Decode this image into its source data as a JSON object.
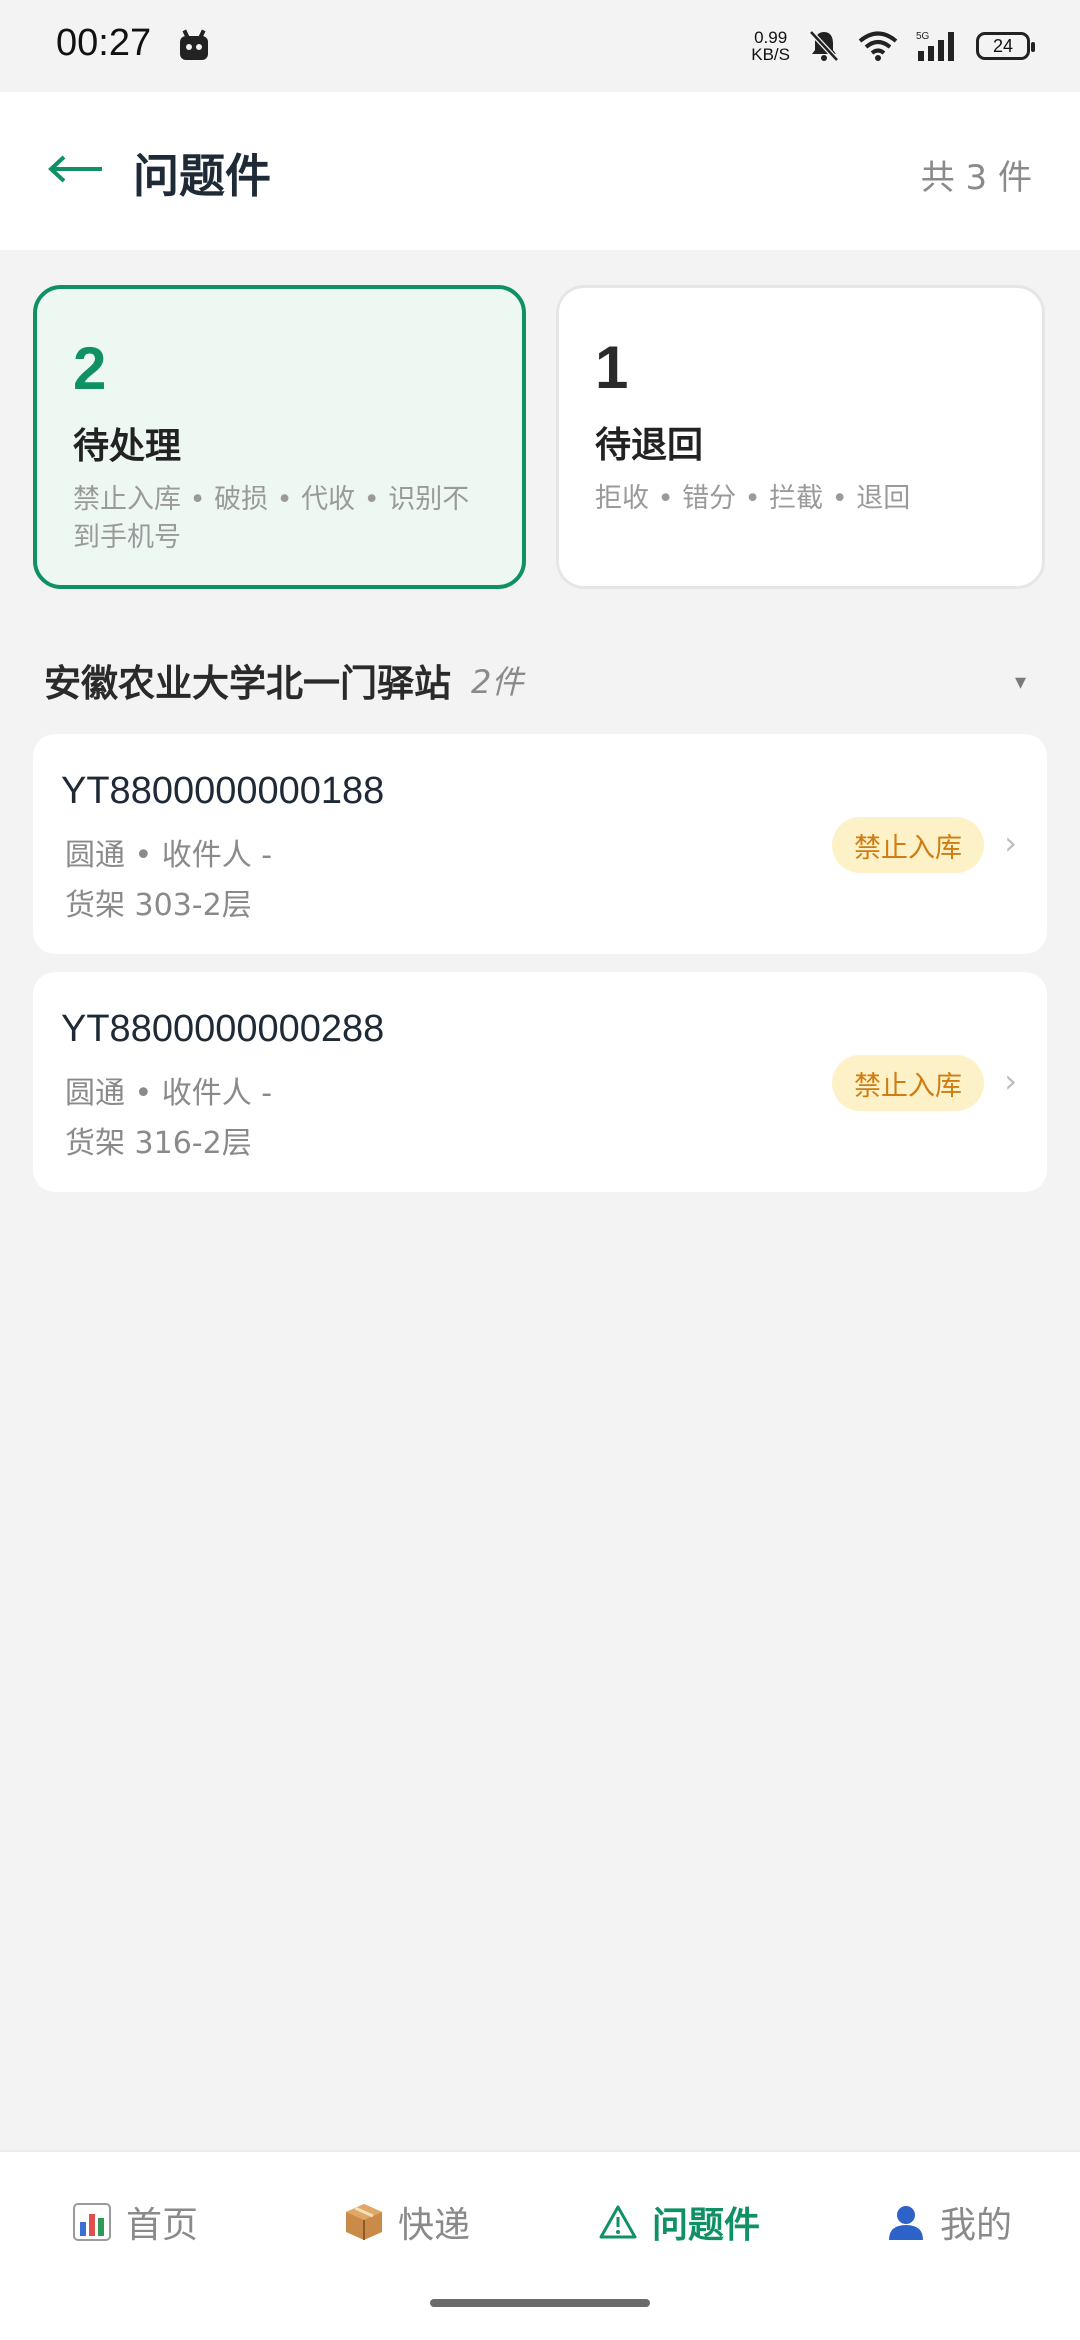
{
  "status_bar": {
    "time": "00:27",
    "net_speed_top": "0.99",
    "net_speed_bottom": "KB/S",
    "battery": "24",
    "icons": [
      "android-icon",
      "mute-bell-icon",
      "wifi-icon",
      "5g-signal-icon",
      "battery-icon"
    ]
  },
  "header": {
    "title": "问题件",
    "total": "共 3 件",
    "back_icon": "arrow-left-icon"
  },
  "summary": {
    "pending": {
      "count": "2",
      "label": "待处理",
      "desc": "禁止入库 • 破损 • 代收 • 识别不到手机号"
    },
    "return": {
      "count": "1",
      "label": "待退回",
      "desc": "拒收 • 错分 • 拦截 • 退回"
    }
  },
  "station": {
    "name": "安徽农业大学北一门驿站",
    "count": "2件",
    "dropdown_icon": "▾"
  },
  "parcels": [
    {
      "id": "YT8800000000188",
      "meta": "圆通 • 收件人 -",
      "shelf": "货架 303-2层",
      "badge": "禁止入库"
    },
    {
      "id": "YT8800000000288",
      "meta": "圆通 • 收件人 -",
      "shelf": "货架 316-2层",
      "badge": "禁止入库"
    }
  ],
  "nav": {
    "home": "首页",
    "express": "快递",
    "issues": "问题件",
    "mine": "我的",
    "active": "issues"
  },
  "colors": {
    "accent": "#0f9165",
    "badge_bg": "#fdf1c7",
    "badge_text": "#d07c10"
  }
}
